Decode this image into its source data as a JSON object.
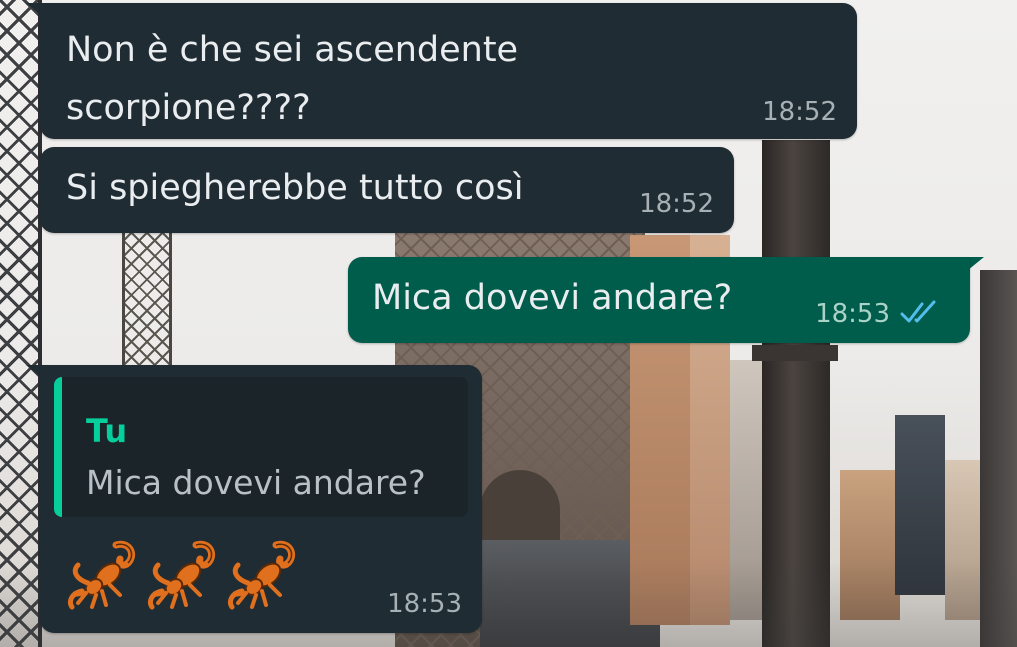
{
  "chat": {
    "messages": [
      {
        "direction": "incoming",
        "lines": [
          "Non è che sei ascendente",
          "scorpione????"
        ],
        "time": "18:52"
      },
      {
        "direction": "incoming",
        "text": "Si spiegherebbe tutto così",
        "time": "18:52"
      },
      {
        "direction": "outgoing",
        "text": "Mica dovevi andare?",
        "time": "18:53",
        "status_icon": "double-check-read-icon"
      },
      {
        "direction": "incoming",
        "quote": {
          "author": "Tu",
          "text": "Mica dovevi andare?"
        },
        "emoji": [
          "scorpion-emoji",
          "scorpion-emoji",
          "scorpion-emoji"
        ],
        "time": "18:53"
      }
    ]
  },
  "colors": {
    "incoming_bubble": "#202c33",
    "outgoing_bubble": "#005c4b",
    "quote_accent": "#06cf9c",
    "read_ticks": "#53bdeb",
    "text": "#e9edef"
  }
}
